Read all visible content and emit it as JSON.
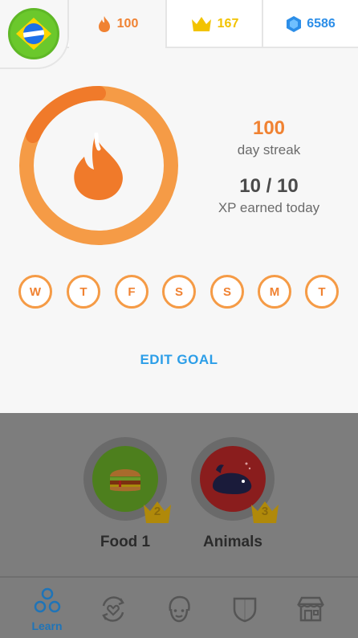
{
  "header": {
    "streak_count": "100",
    "crowns_count": "167",
    "gems_count": "6586"
  },
  "streak_panel": {
    "streak_number": "100",
    "streak_label": "day streak",
    "xp_progress": "10 / 10",
    "xp_label": "XP earned today",
    "goal_fraction": 1.0,
    "days": [
      "W",
      "T",
      "F",
      "S",
      "S",
      "M",
      "T"
    ],
    "edit_goal_label": "EDIT GOAL"
  },
  "skills": [
    {
      "name": "Food 1",
      "crown_level": "2",
      "icon": "hamburger-icon"
    },
    {
      "name": "Animals",
      "crown_level": "3",
      "icon": "whale-icon"
    }
  ],
  "nav": {
    "learn_label": "Learn",
    "items": [
      "learn-icon",
      "practice-heart-icon",
      "profile-face-icon",
      "league-shield-icon",
      "shop-icon"
    ]
  },
  "colors": {
    "streak_orange": "#f08232",
    "ring_orange": "#f59b46",
    "crown_gold": "#f2c300",
    "gem_blue": "#2c8ee8",
    "link_blue": "#2c9ee8",
    "overlay_gray": "#7d7d7d"
  }
}
